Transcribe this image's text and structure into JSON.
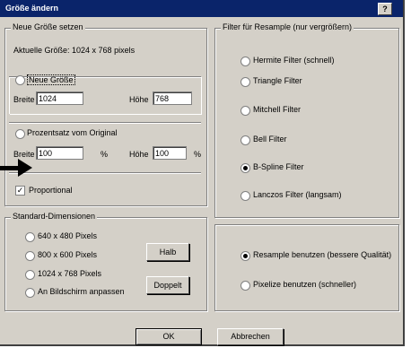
{
  "dialog": {
    "title": "Größe ändern",
    "help_label": "?"
  },
  "new_size": {
    "legend": "Neue Größe setzen",
    "current_size": "Aktuelle Größe:  1024 x 768 pixels",
    "radio_new_size": "Neue Größe",
    "width_label": "Breite",
    "width_value": "1024",
    "height_label": "Höhe",
    "height_value": "768",
    "radio_percent": "Prozentsatz vom Original",
    "pct_width_label": "Breite",
    "pct_width_value": "100",
    "pct_unit": "%",
    "pct_height_label": "Höhe",
    "pct_height_value": "100",
    "pct_unit2": "%",
    "proportional": "Proportional"
  },
  "standard": {
    "legend": "Standard-Dimensionen",
    "options": [
      "640 x 480 Pixels",
      "800 x 600 Pixels",
      "1024 x 768 Pixels",
      "An Bildschirm anpassen"
    ],
    "half_button": "Halb",
    "double_button": "Doppelt"
  },
  "filter": {
    "legend": "Filter für Resample (nur vergrößern)",
    "options": [
      "Hermite Filter (schnell)",
      "Triangle Filter",
      "Mitchell Filter",
      "Bell Filter",
      "B-Spline Filter",
      "Lanczos Filter (langsam)"
    ],
    "selected_index": 4
  },
  "mode": {
    "resample": "Resample benutzen (bessere Qualität)",
    "pixel": "Pixelize benutzen (schneller)"
  },
  "footer": {
    "ok": "OK",
    "cancel": "Abbrechen"
  }
}
